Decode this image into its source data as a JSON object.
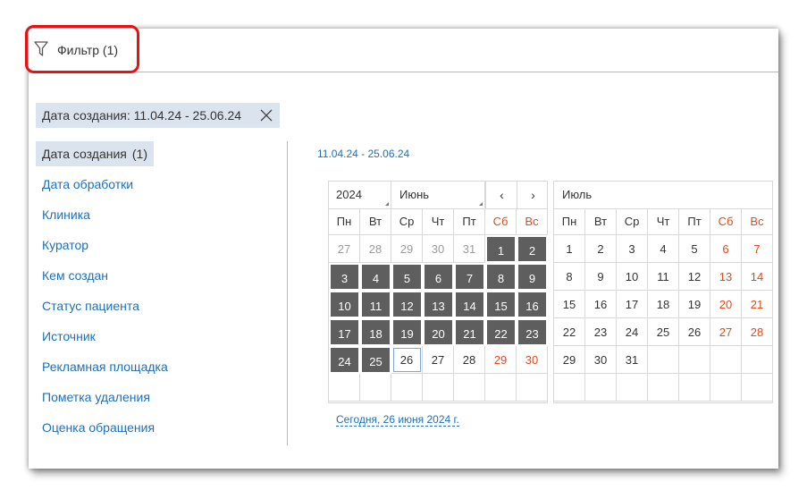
{
  "toolbar": {
    "filter_label": "Фильтр (1)"
  },
  "chip": {
    "label": "Дата создания: 11.04.24 - 25.06.24"
  },
  "menu": {
    "items": [
      {
        "label": "Дата создания",
        "count": "(1)",
        "active": true
      },
      {
        "label": "Дата обработки"
      },
      {
        "label": "Клиника"
      },
      {
        "label": "Куратор"
      },
      {
        "label": "Кем создан"
      },
      {
        "label": "Статус пациента"
      },
      {
        "label": "Источник"
      },
      {
        "label": "Рекламная площадка"
      },
      {
        "label": "Пометка удаления"
      },
      {
        "label": "Оценка обращения"
      }
    ]
  },
  "range_text": "11.04.24 - 25.06.24",
  "weekdays": [
    "Пн",
    "Вт",
    "Ср",
    "Чт",
    "Пт",
    "Сб",
    "Вс"
  ],
  "calendar_left": {
    "year": "2024",
    "month": "Июнь",
    "prev_label": "‹",
    "next_label": "›",
    "weeks": [
      [
        {
          "d": "27",
          "other": true
        },
        {
          "d": "28",
          "other": true
        },
        {
          "d": "29",
          "other": true
        },
        {
          "d": "30",
          "other": true
        },
        {
          "d": "31",
          "other": true
        },
        {
          "d": "1",
          "sel": true
        },
        {
          "d": "2",
          "sel": true
        }
      ],
      [
        {
          "d": "3",
          "sel": true
        },
        {
          "d": "4",
          "sel": true
        },
        {
          "d": "5",
          "sel": true
        },
        {
          "d": "6",
          "sel": true
        },
        {
          "d": "7",
          "sel": true
        },
        {
          "d": "8",
          "sel": true
        },
        {
          "d": "9",
          "sel": true
        }
      ],
      [
        {
          "d": "10",
          "sel": true
        },
        {
          "d": "11",
          "sel": true
        },
        {
          "d": "12",
          "sel": true
        },
        {
          "d": "13",
          "sel": true
        },
        {
          "d": "14",
          "sel": true
        },
        {
          "d": "15",
          "sel": true
        },
        {
          "d": "16",
          "sel": true
        }
      ],
      [
        {
          "d": "17",
          "sel": true
        },
        {
          "d": "18",
          "sel": true
        },
        {
          "d": "19",
          "sel": true
        },
        {
          "d": "20",
          "sel": true
        },
        {
          "d": "21",
          "sel": true
        },
        {
          "d": "22",
          "sel": true
        },
        {
          "d": "23",
          "sel": true
        }
      ],
      [
        {
          "d": "24",
          "sel": true
        },
        {
          "d": "25",
          "sel": true
        },
        {
          "d": "26",
          "today": true
        },
        {
          "d": "27"
        },
        {
          "d": "28"
        },
        {
          "d": "29"
        },
        {
          "d": "30"
        }
      ],
      [
        {
          "d": ""
        },
        {
          "d": ""
        },
        {
          "d": ""
        },
        {
          "d": ""
        },
        {
          "d": ""
        },
        {
          "d": ""
        },
        {
          "d": ""
        }
      ]
    ]
  },
  "calendar_right": {
    "month": "Июль",
    "weeks": [
      [
        {
          "d": "1"
        },
        {
          "d": "2"
        },
        {
          "d": "3"
        },
        {
          "d": "4"
        },
        {
          "d": "5"
        },
        {
          "d": "6"
        },
        {
          "d": "7"
        }
      ],
      [
        {
          "d": "8"
        },
        {
          "d": "9"
        },
        {
          "d": "10"
        },
        {
          "d": "11"
        },
        {
          "d": "12"
        },
        {
          "d": "13"
        },
        {
          "d": "14"
        }
      ],
      [
        {
          "d": "15"
        },
        {
          "d": "16"
        },
        {
          "d": "17"
        },
        {
          "d": "18"
        },
        {
          "d": "19"
        },
        {
          "d": "20"
        },
        {
          "d": "21"
        }
      ],
      [
        {
          "d": "22"
        },
        {
          "d": "23"
        },
        {
          "d": "24"
        },
        {
          "d": "25"
        },
        {
          "d": "26"
        },
        {
          "d": "27"
        },
        {
          "d": "28"
        }
      ],
      [
        {
          "d": "29"
        },
        {
          "d": "30"
        },
        {
          "d": "31"
        },
        {
          "d": ""
        },
        {
          "d": ""
        },
        {
          "d": ""
        },
        {
          "d": ""
        }
      ],
      [
        {
          "d": ""
        },
        {
          "d": ""
        },
        {
          "d": ""
        },
        {
          "d": ""
        },
        {
          "d": ""
        },
        {
          "d": ""
        },
        {
          "d": ""
        }
      ]
    ]
  },
  "today_link": "Сегодня, 26 июня 2024 г.",
  "colors": {
    "accent": "#1e6fb8",
    "selected_day": "#5e5e5e",
    "weekend": "#e04a1c",
    "chip_bg": "#dbe3ee",
    "highlight": "#e81010"
  }
}
